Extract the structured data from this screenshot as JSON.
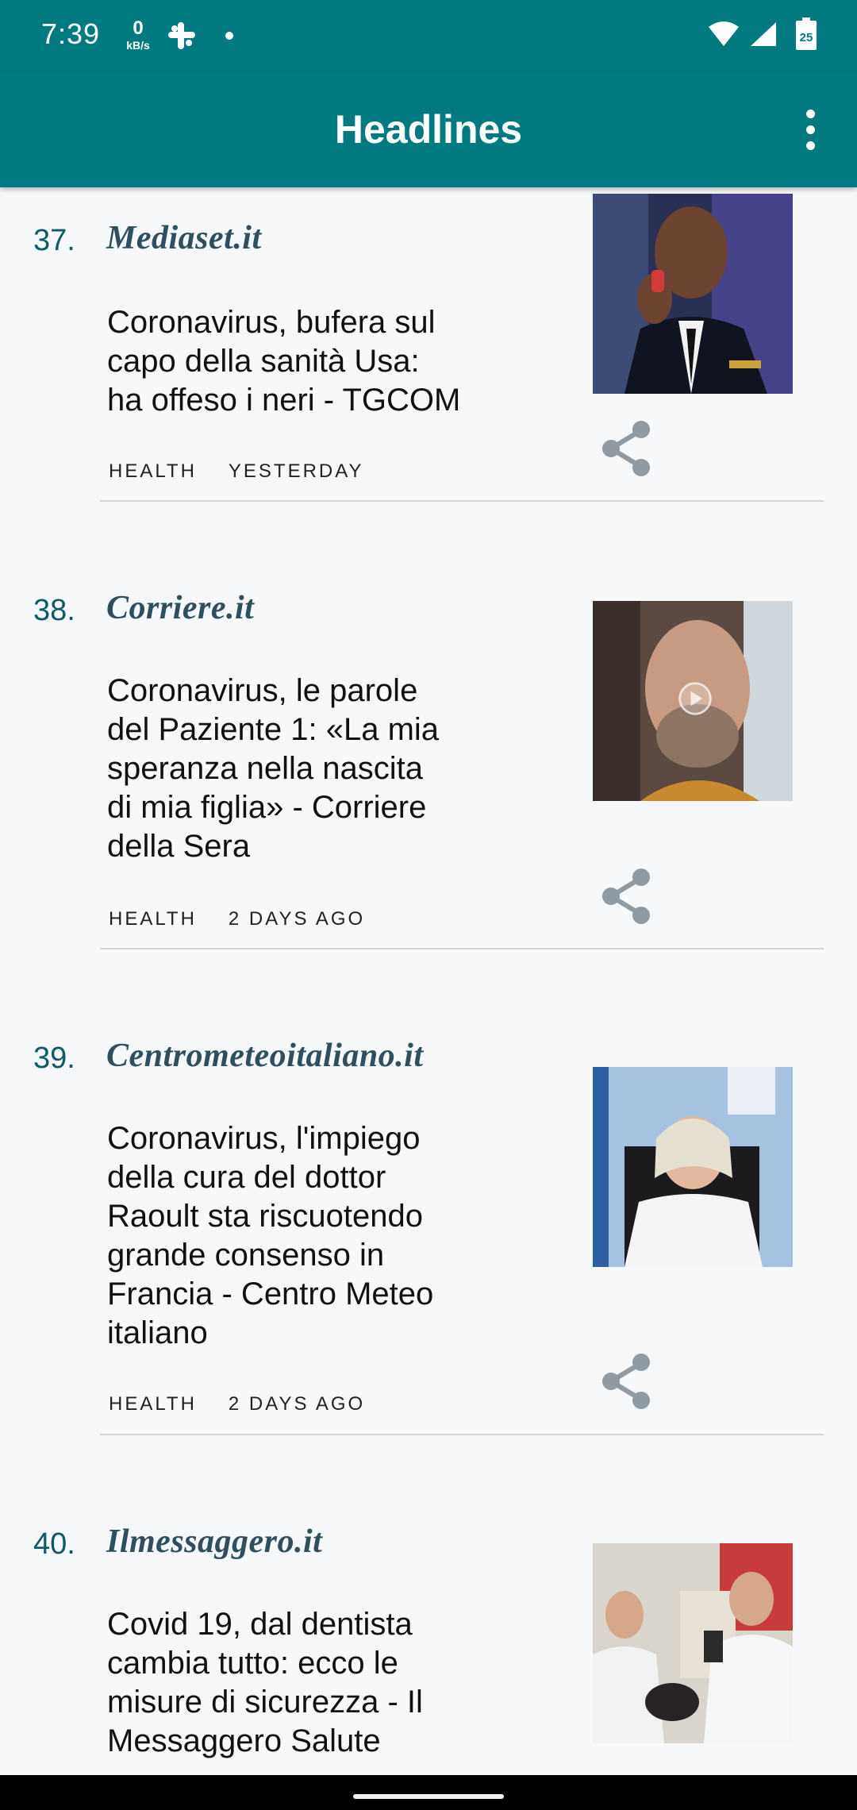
{
  "status_bar": {
    "time": "7:39",
    "net_speed_value": "0",
    "net_speed_unit": "kB/s",
    "battery_level": "25",
    "icons": [
      "slack-icon",
      "dot-icon",
      "wifi-icon",
      "signal-icon",
      "battery-icon"
    ]
  },
  "app_bar": {
    "title": "Headlines",
    "overflow_icon": "more-vert-icon"
  },
  "colors": {
    "app_bar": "#007a80",
    "rank": "#0e5a6a",
    "source": "#2f4f5e",
    "share_icon": "#909aa3"
  },
  "articles": [
    {
      "rank": "37.",
      "source": "Mediaset.it",
      "headline_lines": [
        "Coronavirus, bufera sul",
        "capo della sanità Usa:",
        "ha offeso i neri - TGCOM"
      ],
      "category": "HEALTH",
      "time": "YESTERDAY",
      "thumbnail": "man-in-uniform-with-inhaler-image"
    },
    {
      "rank": "38.",
      "source": "Corriere.it",
      "headline_lines": [
        "Coronavirus, le parole",
        "del Paziente 1: «La mia",
        "speranza nella nascita",
        "di mia figlia» - Corriere",
        "della Sera"
      ],
      "category": "HEALTH",
      "time": "2 DAYS AGO",
      "thumbnail": "bald-man-video-image",
      "has_play": true
    },
    {
      "rank": "39.",
      "source": "Centrometeoitaliano.it",
      "headline_lines": [
        "Coronavirus, l'impiego",
        "della cura del dottor",
        "Raoult sta riscuotendo",
        "grande consenso in",
        "Francia - Centro Meteo",
        "italiano"
      ],
      "category": "HEALTH",
      "time": "2 DAYS AGO",
      "thumbnail": "doctor-in-white-coat-image"
    },
    {
      "rank": "40.",
      "source": "Ilmessaggero.it",
      "headline_lines": [
        "Covid 19, dal dentista",
        "cambia tutto: ecco le",
        "misure di sicurezza - Il",
        "Messaggero Salute"
      ],
      "thumbnail": "dentist-at-work-image"
    }
  ]
}
